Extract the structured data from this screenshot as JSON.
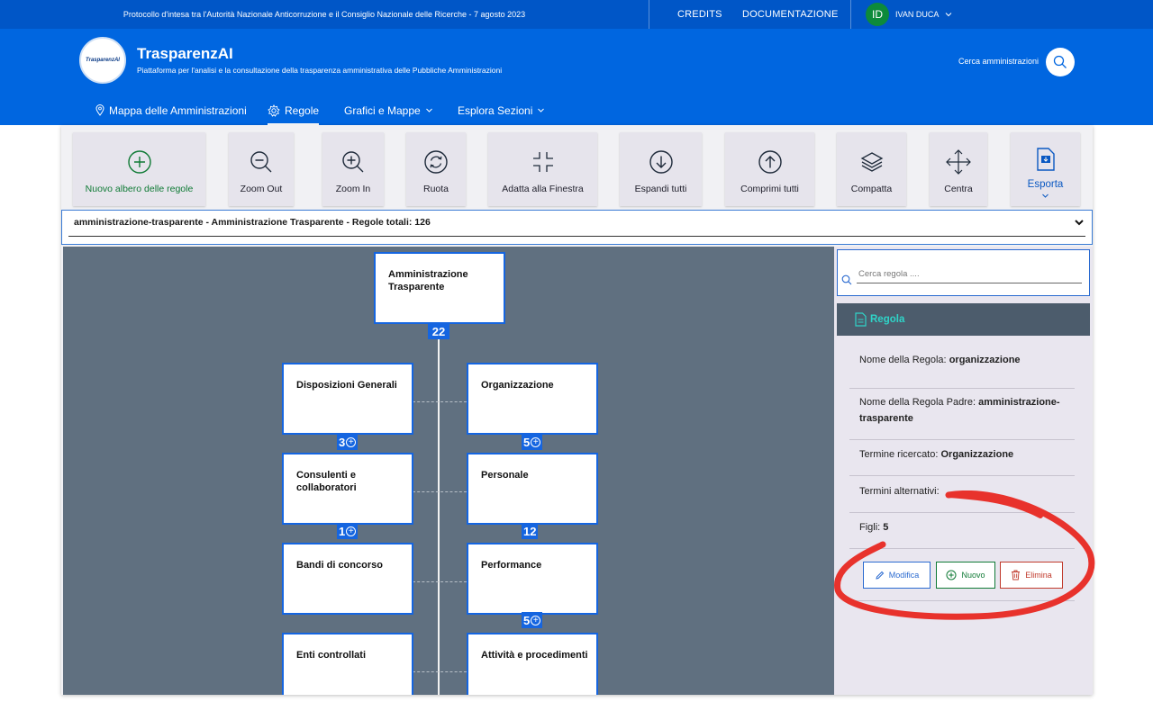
{
  "topbar": {
    "protocol_text": "Protocollo d'intesa tra l'Autorità Nazionale Anticorruzione e il Consiglio Nazionale delle Ricerche - 7 agosto 2023",
    "credits": "CREDITS",
    "documentation": "DOCUMENTAZIONE",
    "user_initials": "ID",
    "user_name": "IVAN DUCA"
  },
  "header": {
    "logo_text": "TrasparenzAI",
    "title": "TrasparenzAI",
    "subtitle": "Piattaforma per l'analisi e la consultazione della trasparenza amministrativa delle Pubbliche Amministrazioni",
    "search_label": "Cerca amministrazioni"
  },
  "nav": {
    "items": [
      {
        "label": "Mappa delle Amministrazioni",
        "icon": "map-pin-icon"
      },
      {
        "label": "Regole",
        "icon": "gear-icon",
        "active": true
      },
      {
        "label": "Grafici e Mappe",
        "icon": "chevron-down-icon"
      },
      {
        "label": "Esplora Sezioni",
        "icon": "chevron-down-icon"
      }
    ]
  },
  "toolbar": {
    "new_tree": "Nuovo albero delle regole",
    "zoom_out": "Zoom Out",
    "zoom_in": "Zoom In",
    "rotate": "Ruota",
    "fit": "Adatta alla Finestra",
    "expand_all": "Espandi tutti",
    "collapse_all": "Comprimi tutti",
    "compact": "Compatta",
    "center": "Centra",
    "export": "Esporta"
  },
  "tree_select": {
    "value": "amministrazione-trasparente - Amministrazione Trasparente - Regole totali: 126"
  },
  "tree": {
    "root": {
      "label": "Amministrazione Trasparente",
      "count": "22"
    },
    "children": [
      {
        "label": "Disposizioni Generali",
        "count": "3"
      },
      {
        "label": "Organizzazione",
        "count": "5"
      },
      {
        "label": "Consulenti e collaboratori",
        "count": "1"
      },
      {
        "label": "Personale",
        "count": "12"
      },
      {
        "label": "Bandi di concorso",
        "count": ""
      },
      {
        "label": "Performance",
        "count": "5"
      },
      {
        "label": "Enti controllati",
        "count": ""
      },
      {
        "label": "Attività e procedimenti",
        "count": ""
      }
    ]
  },
  "panel": {
    "search_placeholder": "Cerca regola ....",
    "header": "Regola",
    "name_label": "Nome della Regola:",
    "name_value": "organizzazione",
    "parent_label": "Nome della Regola Padre:",
    "parent_value": "amministrazione-trasparente",
    "term_label": "Termine ricercato:",
    "term_value": "Organizzazione",
    "alt_label": "Termini alternativi:",
    "children_label": "Figli:",
    "children_value": "5",
    "edit": "Modifica",
    "new": "Nuovo",
    "delete": "Elimina"
  },
  "colors": {
    "primary": "#0066e0",
    "topbar": "#0056c7",
    "canvas": "#607080",
    "node_border": "#1565e0",
    "annotation": "#e8322c",
    "success": "#0f7a35",
    "danger": "#c0392b"
  }
}
